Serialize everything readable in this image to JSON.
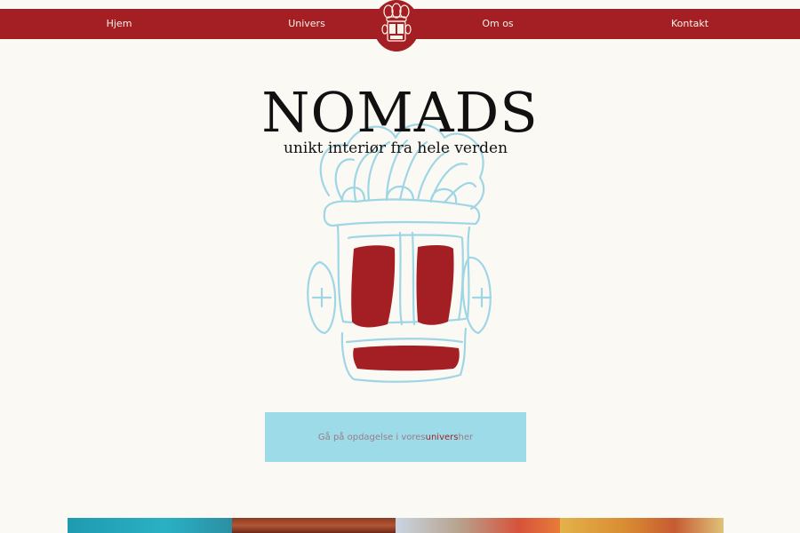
{
  "nav": {
    "items": [
      {
        "label": "Hjem"
      },
      {
        "label": "Univers"
      },
      {
        "label": "Om os"
      },
      {
        "label": "Kontakt"
      }
    ]
  },
  "hero": {
    "title": "NOMADS",
    "subtitle": "unikt interiør fra hele verden"
  },
  "cta": {
    "text_before": "Gå på opdagelse i vores ",
    "text_accent": "univers",
    "text_after": " her"
  },
  "colors": {
    "brand_red": "#a41f23",
    "sky_blue": "#9ddbe9",
    "background": "#fbf9f4"
  },
  "icons": {
    "logo": "mask-logo-icon",
    "hero_art": "mask-illustration"
  }
}
